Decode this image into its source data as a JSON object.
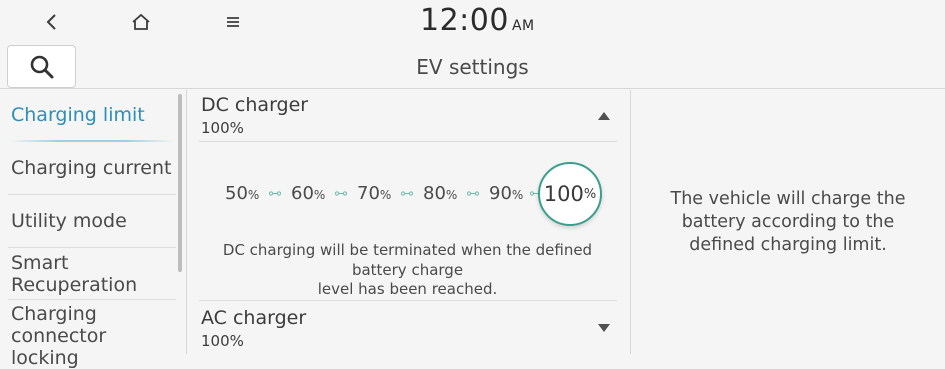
{
  "topbar": {
    "clock": "12:00",
    "ampm": "AM"
  },
  "header": {
    "title": "EV settings"
  },
  "sidebar": {
    "items": [
      {
        "label": "Charging limit"
      },
      {
        "label": "Charging current"
      },
      {
        "label": "Utility mode"
      },
      {
        "label": "Smart\nRecuperation"
      },
      {
        "label": "Charging\nconnector locking"
      }
    ]
  },
  "dc": {
    "title": "DC charger",
    "value": "100%",
    "options": [
      {
        "num": "50",
        "unit": "%"
      },
      {
        "num": "60",
        "unit": "%"
      },
      {
        "num": "70",
        "unit": "%"
      },
      {
        "num": "80",
        "unit": "%"
      },
      {
        "num": "90",
        "unit": "%"
      }
    ],
    "selected": {
      "num": "100",
      "unit": "%"
    },
    "description": "DC charging will be terminated when the defined\nbattery charge\nlevel has been reached."
  },
  "ac": {
    "title": "AC charger",
    "value": "100%"
  },
  "info_text": "The vehicle will charge the\nbattery according to the\ndefined charging limit.",
  "colors": {
    "accent": "#2d8fb5",
    "selected_ring": "#3a9f8f",
    "link_icon": "#6fb9a9"
  },
  "icons": [
    "back-icon",
    "home-icon",
    "menu-icon",
    "search-icon",
    "caret-up-icon",
    "caret-down-icon",
    "link-icon"
  ]
}
